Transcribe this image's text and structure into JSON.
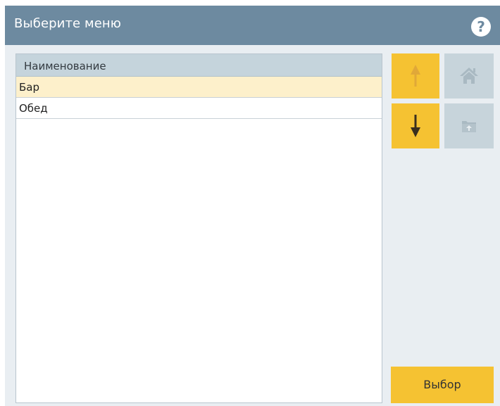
{
  "dialog": {
    "title": "Выберите меню",
    "help_label": "?"
  },
  "list": {
    "column_header": "Наименование",
    "rows": [
      {
        "label": "Бар",
        "selected": true
      },
      {
        "label": "Обед",
        "selected": false
      }
    ]
  },
  "toolbar": {
    "up_icon": "arrow-up-icon",
    "down_icon": "arrow-down-icon",
    "home_icon": "home-icon",
    "folder_up_icon": "folder-up-icon",
    "select_label": "Выбор"
  },
  "colors": {
    "title_bar": "#6d8aa0",
    "accent_yellow": "#f5c232",
    "selected_row": "#fdf0cb",
    "disabled_button": "#c7d4db",
    "list_header": "#c5d4dc",
    "background": "#e9eef2"
  }
}
